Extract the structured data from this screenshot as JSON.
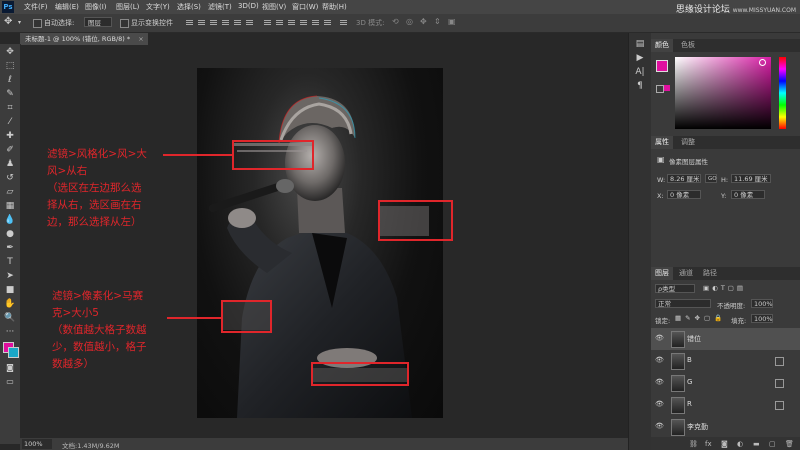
{
  "menu": {
    "items": [
      "文件(F)",
      "编辑(E)",
      "图像(I)",
      "图层(L)",
      "文字(Y)",
      "选择(S)",
      "滤镜(T)",
      "3D(D)",
      "视图(V)",
      "窗口(W)",
      "帮助(H)"
    ],
    "watermark": "思缘设计论坛",
    "watermark_url": "www.MISSYUAN.COM"
  },
  "options": {
    "auto_select_label": "自动选择:",
    "auto_select_value": "图层",
    "show_transform_label": "显示变换控件",
    "mode_3d_label": "3D 模式:"
  },
  "document": {
    "tab_title": "未标题-1 @ 100% (错位, RGB/8) *",
    "zoom": "100%",
    "doc_info": "文档:1.43M/9.62M"
  },
  "annotations": {
    "wind_note": "滤镜>风格化>风>大\n风>从右\n（选区在左边那么选\n择从右，选区画在右\n边，那么选择从左）",
    "mosaic_note": "滤镜>像素化>马赛\n克>大小5\n（数值越大格子数越\n少，数值越小，格子\n数越多）"
  },
  "color_panel": {
    "tabs": [
      "颜色",
      "色板"
    ],
    "fg_color": "#e0109f",
    "bg_color": "#1aa7c7"
  },
  "properties_panel": {
    "tabs": [
      "属性",
      "调整"
    ],
    "title": "像素图层属性",
    "w_label": "W:",
    "w_value": "8.26 厘米",
    "h_label": "H:",
    "h_value": "11.69 厘米",
    "x_label": "X:",
    "x_value": "0 像素",
    "y_label": "Y:",
    "y_value": "0 像素",
    "link_label": "GO"
  },
  "layers_panel": {
    "tabs": [
      "图层",
      "通道",
      "路径"
    ],
    "filter_kind": "ρ类型",
    "blend_mode": "正常",
    "opacity_label": "不透明度:",
    "opacity_value": "100%",
    "lock_label": "锁定:",
    "fill_label": "填充:",
    "fill_value": "100%",
    "layers": [
      {
        "name": "错位",
        "selected": true
      },
      {
        "name": "B",
        "selected": false
      },
      {
        "name": "G",
        "selected": false
      },
      {
        "name": "R",
        "selected": false
      },
      {
        "name": "李克勤",
        "selected": false
      }
    ]
  }
}
